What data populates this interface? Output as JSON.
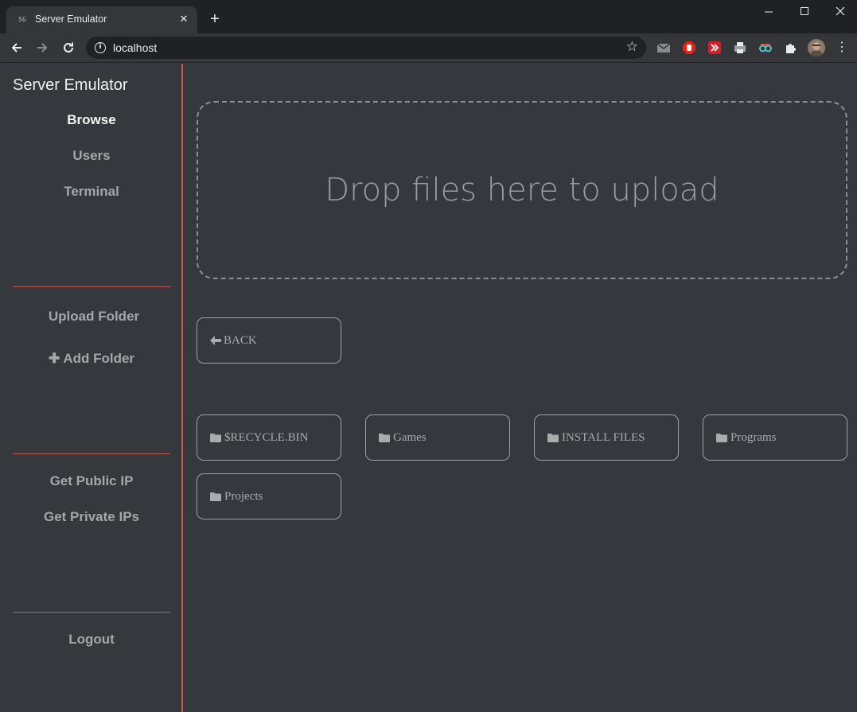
{
  "browser": {
    "tab_title": "Server Emulator",
    "tab_favicon_text": "SG",
    "url": "localhost",
    "window_controls": [
      "minimize-icon",
      "maximize-icon",
      "close-icon"
    ]
  },
  "sidebar": {
    "brand": "Server Emulator",
    "nav": [
      {
        "label": "Browse",
        "active": true
      },
      {
        "label": "Users",
        "active": false
      },
      {
        "label": "Terminal",
        "active": false
      }
    ],
    "folder_actions": {
      "upload_folder": "Upload Folder",
      "add_folder": "Add Folder"
    },
    "ip_actions": {
      "public_ip": "Get Public IP",
      "private_ips": "Get Private IPs"
    },
    "logout": "Logout"
  },
  "main": {
    "dropzone_text": "Drop files here to upload",
    "back_label": "BACK",
    "folders": [
      "$RECYCLE.BIN",
      "Games",
      "INSTALL FILES",
      "Programs",
      "Projects"
    ]
  },
  "colors": {
    "accent_divider": "#c05a52",
    "background": "#35383c"
  }
}
